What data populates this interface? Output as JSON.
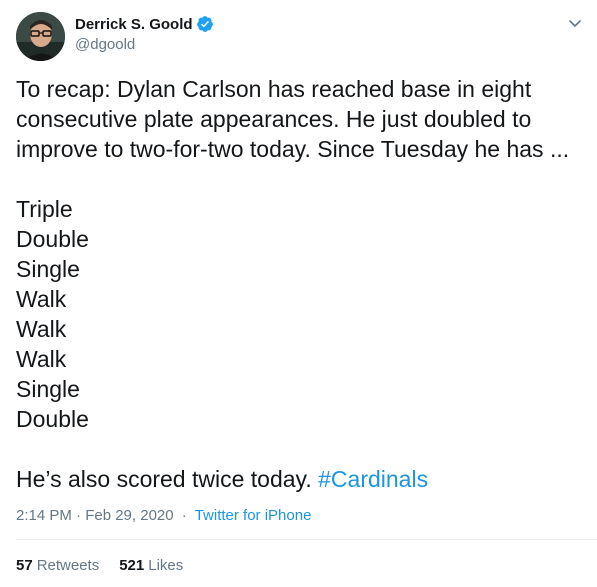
{
  "author": {
    "display_name": "Derrick S. Goold",
    "handle": "@dgoold",
    "verified": true,
    "verified_color": "#1da1f2"
  },
  "tweet": {
    "intro": "To recap: Dylan Carlson has reached base in eight consecutive plate appearances. He just doubled to improve to two-for-two today. Since Tuesday he has ...",
    "results": [
      "Triple",
      "Double",
      "Single",
      "Walk",
      "Walk",
      "Walk",
      "Single",
      "Double"
    ],
    "closing_text": "He’s also scored twice today. ",
    "hashtag": "#Cardinals"
  },
  "meta": {
    "timestamp": "2:14 PM · Feb 29, 2020",
    "separator": "·",
    "source": "Twitter for iPhone"
  },
  "stats": {
    "retweets_count": "57",
    "retweets_label": "Retweets",
    "likes_count": "521",
    "likes_label": "Likes"
  },
  "icons": {
    "verified": "verified-badge-icon",
    "menu": "chevron-down-icon"
  },
  "colors": {
    "link": "#1b95e0",
    "muted": "#657786",
    "text": "#14171a"
  }
}
